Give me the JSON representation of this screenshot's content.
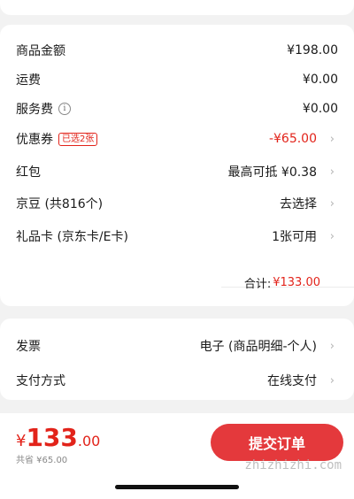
{
  "summary": {
    "rows": [
      {
        "label": "商品金额",
        "value": "¥198.00"
      },
      {
        "label": "运费",
        "value": "¥0.00"
      },
      {
        "label": "服务费",
        "value": "¥0.00"
      },
      {
        "label": "优惠券",
        "badge": "已选2张",
        "value": "-¥65.00"
      },
      {
        "label": "红包",
        "value": "最高可抵 ¥0.38"
      },
      {
        "label": "京豆 (共816个)",
        "value": "去选择"
      },
      {
        "label": "礼品卡 (京东卡/E卡)",
        "value": "1张可用"
      }
    ],
    "total_label": "合计:",
    "total_value": "¥133.00"
  },
  "extra": {
    "invoice_label": "发票",
    "invoice_value": "电子 (商品明细-个人)",
    "payment_label": "支付方式",
    "payment_value": "在线支付"
  },
  "footer": {
    "currency": "¥",
    "price_int": "133",
    "price_dec": ".00",
    "saved": "共省 ¥65.00",
    "submit_label": "提交订单",
    "watermark": "zhizhizhi.com"
  },
  "colors": {
    "accent": "#e2231a",
    "button": "#e4393c",
    "page_bg": "#f2f2f2"
  }
}
